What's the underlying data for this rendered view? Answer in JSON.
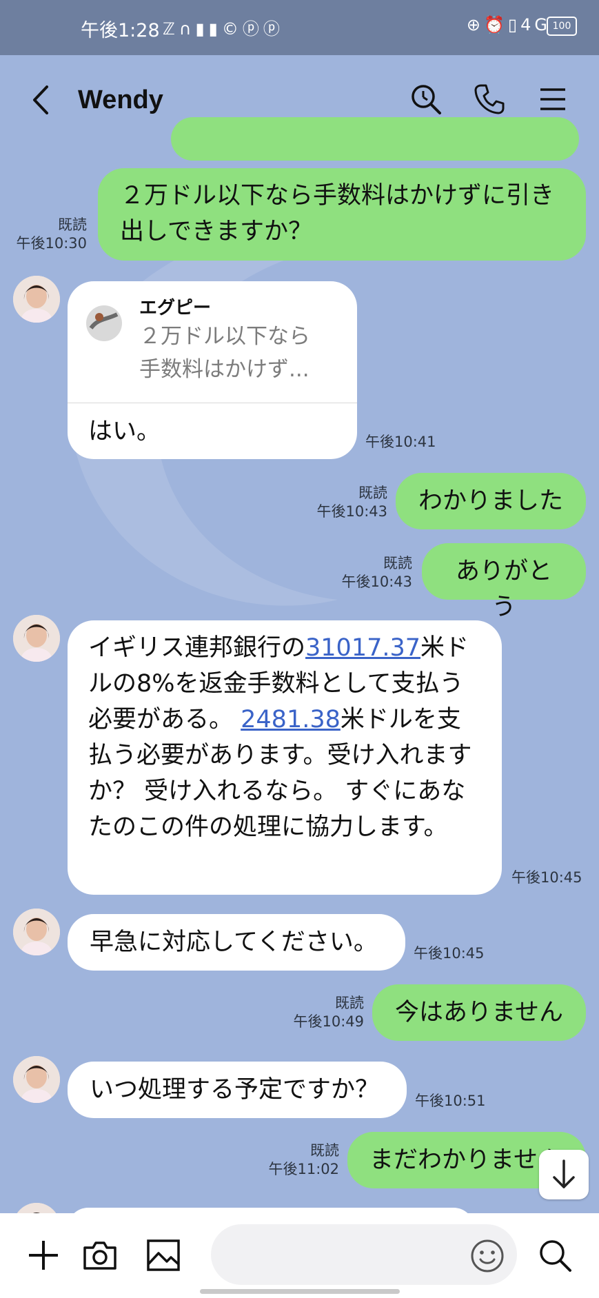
{
  "status_bar": {
    "time": "午後1:28",
    "left_icons": "ℤ∩▮▮©ⓟⓟ",
    "right_icons": "⊕⏰▯4G",
    "battery": "100"
  },
  "header": {
    "title": "Wendy"
  },
  "messages": [
    {
      "side": "out",
      "text": "２万ドル以下なら手数料はかけずに引き出しできますか？",
      "read": "既読",
      "time": "午後10:30"
    },
    {
      "side": "in",
      "quote_name": "エグピー",
      "quote_text_1": "２万ドル以下なら",
      "quote_text_2": "手数料はかけず...",
      "text": "はい。",
      "time": "午後10:41"
    },
    {
      "side": "out",
      "text": "わかりました",
      "read": "既読",
      "time": "午後10:43"
    },
    {
      "side": "out",
      "text": "ありがとう",
      "read": "既読",
      "time": "午後10:43"
    },
    {
      "side": "in",
      "text_a": "イギリス連邦銀行の",
      "link_a": "31017.37",
      "text_b": "米ドルの8%を返金手数料として支払う必要がある。 ",
      "link_b": "2481.38",
      "text_c": "米ドルを支払う必要があります。受け入れますか？ 受け入れるなら。 すぐにあなたのこの件の処理に協力します。",
      "time": "午後10:45"
    },
    {
      "side": "in",
      "text": "早急に対応してください。",
      "time": "午後10:45"
    },
    {
      "side": "out",
      "text": "今はありません",
      "read": "既読",
      "time": "午後10:49"
    },
    {
      "side": "in",
      "text": "いつ処理する予定ですか？",
      "time": "午後10:51"
    },
    {
      "side": "out",
      "text": "まだわかりません",
      "read": "既読",
      "time": "午後11:02"
    }
  ],
  "input": {
    "placeholder": ""
  }
}
